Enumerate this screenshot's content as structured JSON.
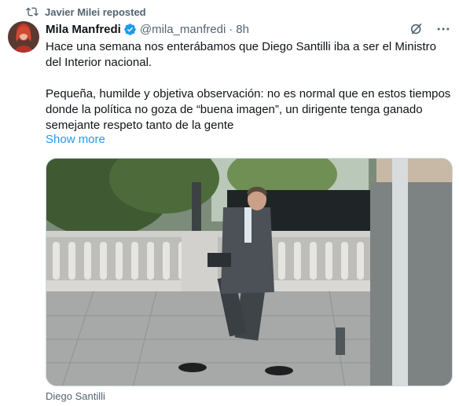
{
  "repost": {
    "text": "Javier Milei reposted",
    "icon": "repost-icon"
  },
  "author": {
    "name": "Mila Manfredi",
    "handle": "@mila_manfredi",
    "separator": "·",
    "time": "8h"
  },
  "tweet": {
    "paragraphs": [
      "Hace una semana nos enterábamos que Diego Santilli iba a ser el Ministro del Interior nacional.",
      "Pequeña, humilde y objetiva observación: no es normal que en estos tiempos donde la política no goza de “buena imagen”, un dirigente tenga ganado semejante respeto tanto de la gente"
    ],
    "show_more": "Show more"
  },
  "media": {
    "caption": "Diego Santilli"
  },
  "colors": {
    "link": "#1d9bf0",
    "secondary_text": "#536471",
    "verified": "#1d9bf0"
  }
}
